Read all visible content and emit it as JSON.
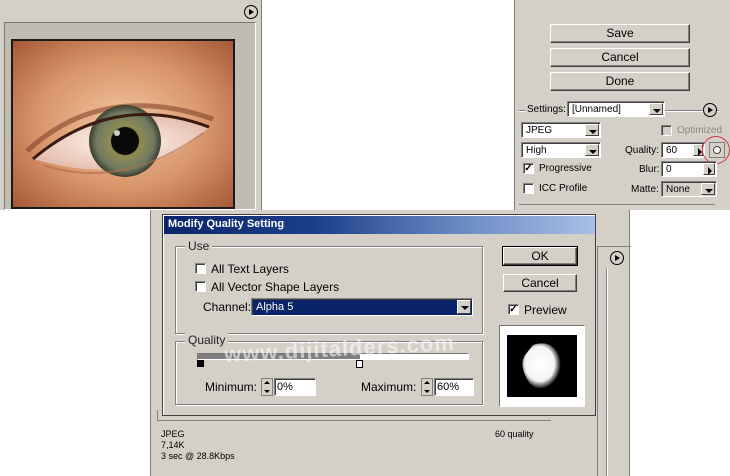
{
  "save_panel": {
    "save_label": "Save",
    "cancel_label": "Cancel",
    "done_label": "Done",
    "settings_label": "Settings:",
    "settings_value": "[Unnamed]",
    "format_value": "JPEG",
    "quality_preset_value": "High",
    "optimized_label": "Optimized",
    "quality_label": "Quality:",
    "quality_value": "60",
    "progressive_label": "Progressive",
    "blur_label": "Blur:",
    "blur_value": "0",
    "icc_profile_label": "ICC Profile",
    "matte_label": "Matte:",
    "matte_value": "None"
  },
  "preview_info": {
    "format": "JPEG",
    "size": "7,14K",
    "time": "3 sec @ 28.8Kbps",
    "quality": "60 quality"
  },
  "dialog": {
    "title": "Modify Quality Setting",
    "use_group_label": "Use",
    "all_text_layers_label": "All Text Layers",
    "all_vector_shape_layers_label": "All Vector Shape Layers",
    "channel_label": "Channel:",
    "channel_value": "Alpha 5",
    "quality_group_label": "Quality",
    "minimum_label": "Minimum:",
    "minimum_value": "0%",
    "maximum_label": "Maximum:",
    "maximum_value": "60%",
    "ok_label": "OK",
    "cancel_label": "Cancel",
    "preview_label": "Preview",
    "slider_max_fraction": 0.6,
    "slider_min_fraction": 0.0
  },
  "watermark": "www.dijitalders.com",
  "icons": [
    "panel-menu-arrow-icon",
    "eye-photo",
    "quality-mask-icon",
    "alpha-channel-thumbnail"
  ],
  "colors": {
    "panel_gray": "#d4d0c8",
    "title_bar": "#0a246a",
    "selected_highlight": "#0a246a",
    "highlight_circle": "#d9344a"
  }
}
